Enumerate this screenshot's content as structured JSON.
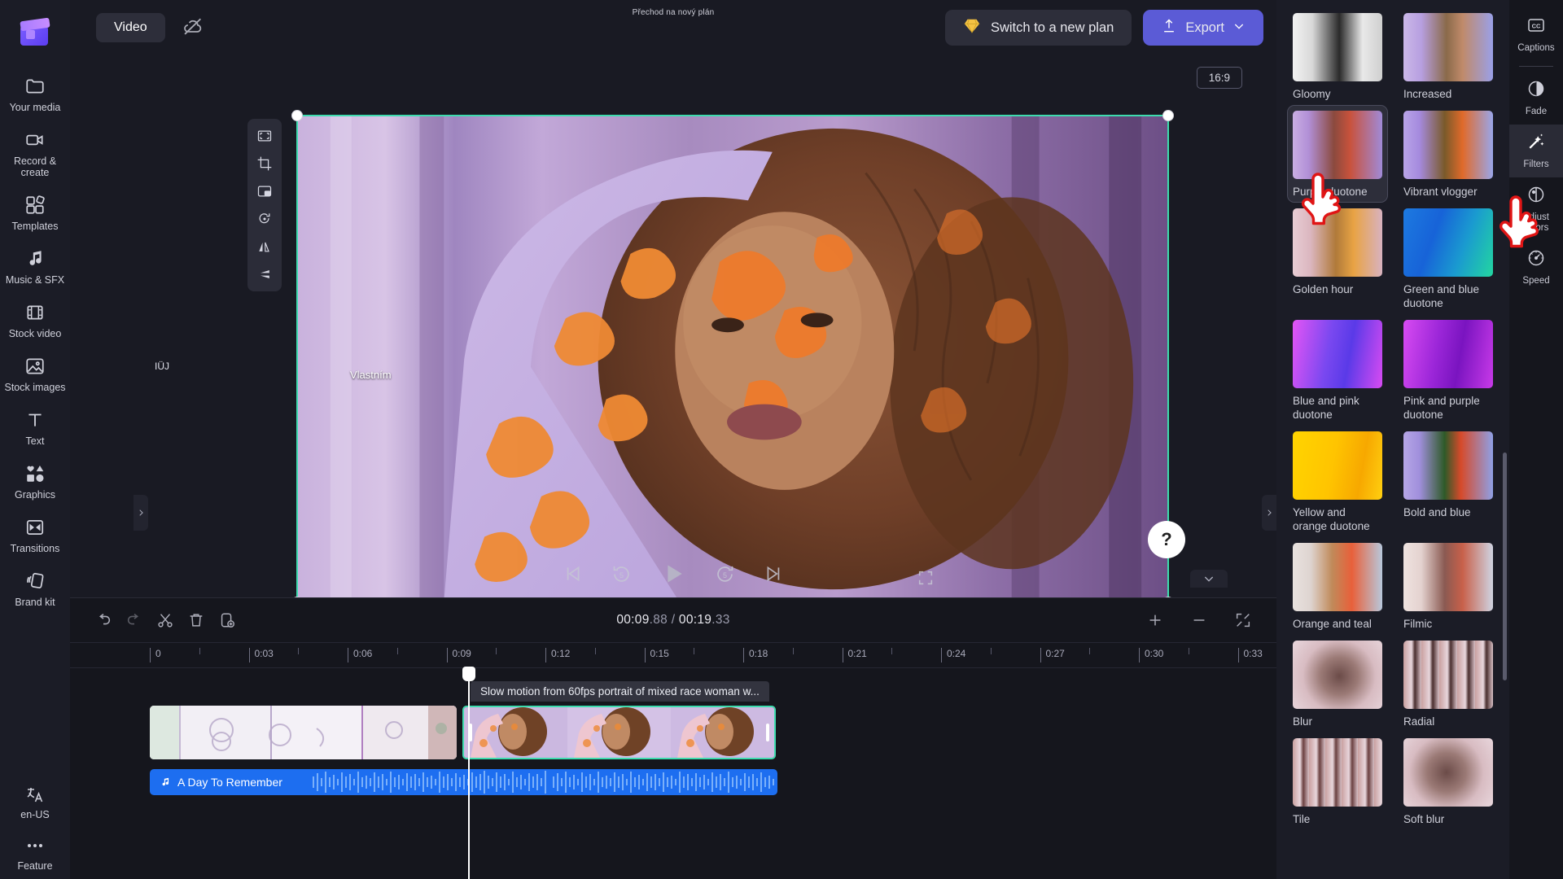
{
  "app": {
    "logo_name": "clipchamp-logo",
    "center_title": "Přechod na nový plán",
    "video_chip": "Video",
    "cloud_icon": "cloud-off-icon"
  },
  "sidebar": {
    "items": [
      {
        "label": "Your media",
        "icon": "folder-icon"
      },
      {
        "label": "Record & create",
        "icon": "video-camera-icon"
      },
      {
        "label": "Templates",
        "icon": "templates-icon"
      },
      {
        "label": "Music & SFX",
        "icon": "music-note-icon"
      },
      {
        "label": "Stock video",
        "icon": "film-strip-icon"
      },
      {
        "label": "Stock images",
        "icon": "image-icon"
      },
      {
        "label": "Text",
        "icon": "text-t-icon"
      },
      {
        "label": "Graphics",
        "icon": "shapes-icon"
      },
      {
        "label": "Transitions",
        "icon": "transitions-icon"
      },
      {
        "label": "Brand kit",
        "icon": "brand-kit-icon"
      }
    ],
    "locale": {
      "label": "en-US",
      "icon": "language-icon"
    },
    "more": {
      "label": "Feature",
      "icon": "ellipsis-icon"
    }
  },
  "topbar": {
    "plan_button": "Switch to a new plan",
    "plan_icon": "diamond-icon",
    "export_button": "Export",
    "export_icon": "upload-arrow-icon",
    "export_chevron": "chevron-down-icon",
    "accent_purple": "#5b5bd6",
    "gem_yellow": "#f5c344"
  },
  "stage": {
    "aspect_ratio": "16:9",
    "overlay_caption": "Vlastním",
    "corner_text": "IÜJ",
    "selection_color": "#3ddcae",
    "float_tools": [
      {
        "icon": "fit-to-frame-icon",
        "name": "fit-frame"
      },
      {
        "icon": "crop-icon",
        "name": "crop"
      },
      {
        "icon": "picture-in-picture-icon",
        "name": "pip"
      },
      {
        "icon": "rotate-icon",
        "name": "rotate"
      },
      {
        "icon": "flip-horizontal-icon",
        "name": "flip-horizontal"
      },
      {
        "icon": "flip-vertical-icon",
        "name": "flip-vertical"
      }
    ],
    "player_controls": [
      {
        "icon": "skip-to-start-icon",
        "name": "skip-start"
      },
      {
        "icon": "rewind-5-icon",
        "name": "rewind-5",
        "value": "5"
      },
      {
        "icon": "play-icon",
        "name": "play"
      },
      {
        "icon": "forward-5-icon",
        "name": "forward-5",
        "value": "5"
      },
      {
        "icon": "skip-to-end-icon",
        "name": "skip-end"
      }
    ],
    "fullscreen_icon": "fullscreen-icon",
    "help_label": "?"
  },
  "timeline": {
    "tools": [
      {
        "icon": "undo-icon",
        "name": "undo"
      },
      {
        "icon": "redo-icon",
        "name": "redo"
      },
      {
        "icon": "scissors-icon",
        "name": "split"
      },
      {
        "icon": "trash-icon",
        "name": "delete"
      },
      {
        "icon": "duplicate-icon",
        "name": "duplicate"
      }
    ],
    "current_time": "00:09",
    "current_frac": ".88",
    "separator": " / ",
    "total_time": "00:19",
    "total_frac": ".33",
    "zoom_in_icon": "plus-icon",
    "zoom_out_icon": "minus-icon",
    "fit_icon": "fit-timeline-icon",
    "ruler_ticks": [
      "0",
      "0:03",
      "0:06",
      "0:09",
      "0:12",
      "0:15",
      "0:18",
      "0:21",
      "0:24",
      "0:27",
      "0:30",
      "0:33",
      "0"
    ],
    "clip_tooltip": "Slow motion from 60fps portrait of mixed race woman w...",
    "audio_track": {
      "name": "A Day To Remember",
      "icon": "music-note-icon",
      "color": "#1d6ef0"
    },
    "playhead_time": "00:09.88"
  },
  "filters": {
    "selected": "Purple duotone",
    "items": [
      {
        "label": "Gloomy",
        "css": "linear-gradient(90deg,#f2f2f2 0%,#d8d8d8 22%,#2a2a2a 52%,#e9e9e9 78%,#cfcfcf 100%)"
      },
      {
        "label": "Increased",
        "css": "linear-gradient(90deg,#cbb8e8 0%,#b79fe0 20%,#8a6a4a 48%,#c08a6a 66%,#9aa0e8 100%)"
      },
      {
        "label": "Purple duotone",
        "css": "linear-gradient(90deg,#c9aee3 0%,#b18fd6 18%,#8b4a3e 46%,#c8523c 64%,#a08ad8 100%)"
      },
      {
        "label": "Vibrant vlogger",
        "css": "linear-gradient(90deg,#b9a4e8 0%,#a58ade 18%,#7a5a2a 46%,#e06a2a 66%,#9aa6ea 100%)"
      },
      {
        "label": "Golden hour",
        "css": "linear-gradient(90deg,#e8cdd4 0%,#dbb6bf 20%,#b07a3a 48%,#e8a344 68%,#d8b2c0 100%)"
      },
      {
        "label": "Green and blue duotone",
        "css": "linear-gradient(110deg,#1d7ae0 0%,#1763d8 35%,#1a9ad0 65%,#23d6a0 100%)"
      },
      {
        "label": "Blue and pink duotone",
        "css": "linear-gradient(100deg,#e455f5 0%,#7a48f0 40%,#5a3ae8 62%,#d84bf2 100%)"
      },
      {
        "label": "Pink and purple duotone",
        "css": "linear-gradient(100deg,#d84bf2 0%,#9b26d8 38%,#7a14c0 62%,#c83ae8 100%)"
      },
      {
        "label": "Yellow and orange duotone",
        "css": "linear-gradient(100deg,#ffd400 0%,#ffc400 45%,#f7a800 75%,#ffcf10 100%)"
      },
      {
        "label": "Bold and blue",
        "css": "linear-gradient(90deg,#b6a6e6 0%,#a08fdc 18%,#2e5a28 46%,#d64a2a 64%,#8fa0e6 100%)"
      },
      {
        "label": "Orange and teal",
        "css": "linear-gradient(90deg,#e8e2df 0%,#ded4d0 20%,#c08a5a 44%,#e8603a 66%,#b8c8dc 100%)"
      },
      {
        "label": "Filmic",
        "css": "linear-gradient(90deg,#efe3e0 0%,#e4d2cf 20%,#8a5a52 46%,#c8604a 66%,#cfd4e2 100%)"
      },
      {
        "label": "Blur",
        "css": "radial-gradient(circle at 52% 52%, #6b4b48 0%, #9b7a76 32%, #d8bcc2 62%, #e8d6dc 100%)"
      },
      {
        "label": "Radial",
        "css": "repeating-linear-gradient(90deg,#c9a0a0 0px,#e8d6dc 10px,#4a2e2e 14px,#d8c0c6 22px)"
      },
      {
        "label": "Tile",
        "css": "repeating-linear-gradient(90deg,#c9a0a0 0px,#e8d6dc 9px,#6a4040 13px,#d8c0c6 20px)"
      },
      {
        "label": "Soft blur",
        "css": "radial-gradient(circle at 48% 50%, #6b4b48 0%, #9b7a76 34%, #d8bcc2 64%, #e8d6dc 100%)"
      }
    ]
  },
  "properties": {
    "items": [
      {
        "label": "Captions",
        "icon": "captions-cc-icon",
        "active": false
      },
      {
        "label": "Fade",
        "icon": "fade-circle-icon",
        "active": false
      },
      {
        "label": "Filters",
        "icon": "magic-wand-icon",
        "active": true
      },
      {
        "label": "Adjust colors",
        "icon": "adjust-colors-icon",
        "active": false
      },
      {
        "label": "Speed",
        "icon": "speedometer-icon",
        "active": false
      }
    ]
  },
  "cursors": [
    {
      "name": "pointing-hand-cursor-filters-grid"
    },
    {
      "name": "pointing-hand-cursor-filters-tab"
    }
  ]
}
